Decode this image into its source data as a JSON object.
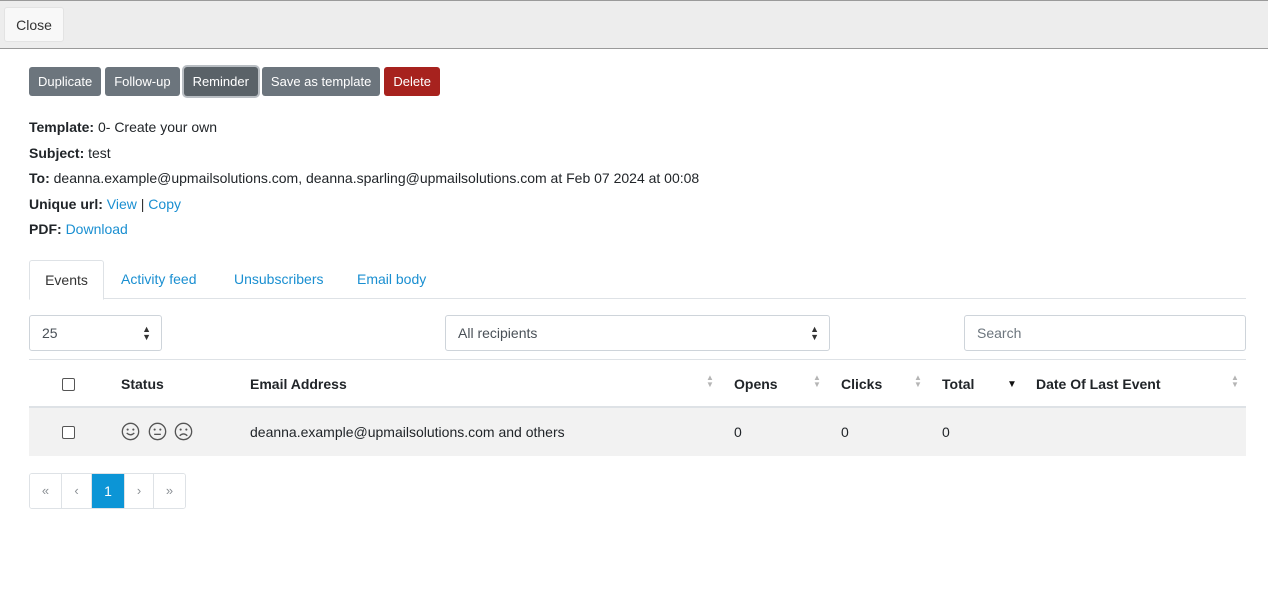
{
  "topbar": {
    "close_label": "Close"
  },
  "actions": [
    {
      "label": "Duplicate"
    },
    {
      "label": "Follow-up"
    },
    {
      "label": "Reminder"
    },
    {
      "label": "Save as template"
    },
    {
      "label": "Delete"
    }
  ],
  "details": {
    "template_label": "Template:",
    "template_value": "0- Create your own",
    "subject_label": "Subject:",
    "subject_value": "test",
    "to_label": "To:",
    "to_value": "deanna.example@upmailsolutions.com, deanna.sparling@upmailsolutions.com at Feb 07 2024 at 00:08",
    "unique_url_label": "Unique url:",
    "view_link": "View",
    "separator": "|",
    "copy_link": "Copy",
    "pdf_label": "PDF:",
    "download_link": "Download"
  },
  "tabs": [
    {
      "label": "Events"
    },
    {
      "label": "Activity feed"
    },
    {
      "label": "Unsubscribers"
    },
    {
      "label": "Email body"
    }
  ],
  "controls": {
    "page_size": "25",
    "recipients_filter": "All recipients",
    "search_placeholder": "Search"
  },
  "table": {
    "columns": [
      "Status",
      "Email Address",
      "Opens",
      "Clicks",
      "Total",
      "Date Of Last Event"
    ],
    "rows": [
      {
        "email": "deanna.example@upmailsolutions.com and others",
        "opens": "0",
        "clicks": "0",
        "total": "0",
        "date": ""
      }
    ]
  },
  "pagination": {
    "first": "«",
    "prev": "‹",
    "current": "1",
    "next": "›",
    "last": "»"
  },
  "colors": {
    "accent": "#0c95d6",
    "link": "#1a8fd1",
    "danger": "#a7221e",
    "secondary": "#6c757d"
  }
}
